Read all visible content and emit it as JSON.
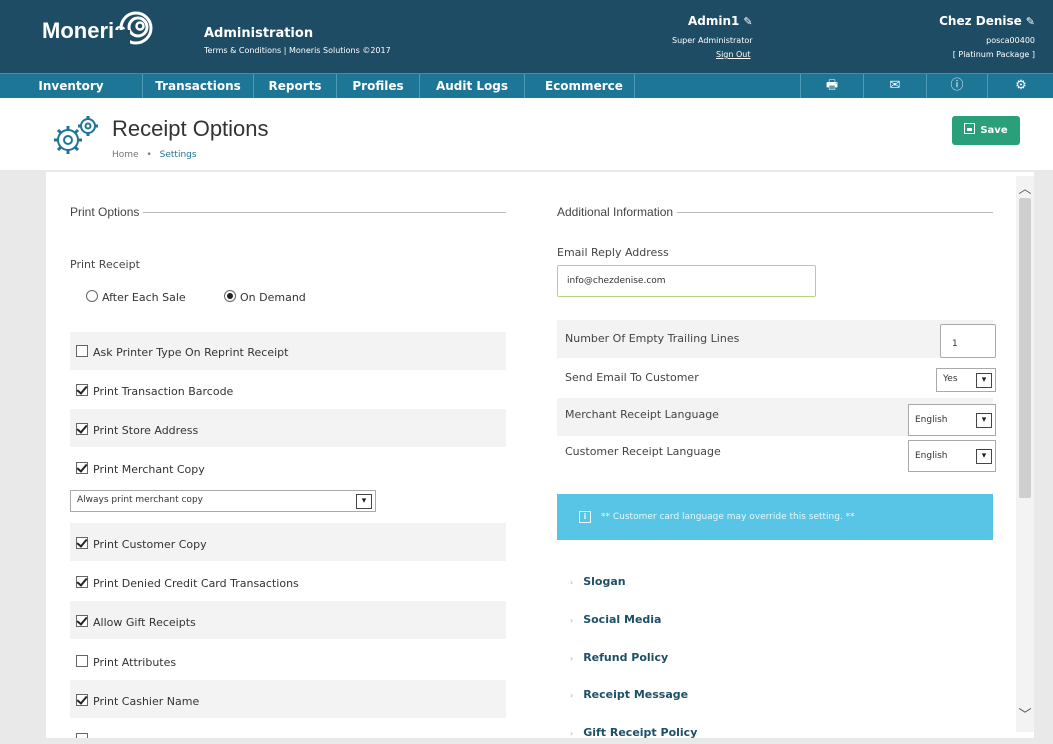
{
  "header": {
    "logo_text": "Moneris",
    "admin_title": "Administration",
    "admin_sub": "Terms & Conditions | Moneris Solutions ©2017",
    "user_name": "Admin1",
    "user_role": "Super Administrator",
    "sign_out": "Sign Out",
    "store_name": "Chez Denise",
    "store_id": "posca00400",
    "store_package": "[ Platinum Package ]"
  },
  "nav": {
    "items": [
      "Inventory",
      "Transactions",
      "Reports",
      "Profiles",
      "Audit Logs",
      "Ecommerce"
    ],
    "icons": [
      "printer-icon",
      "mail-icon",
      "help-icon",
      "settings-icon"
    ]
  },
  "page": {
    "title": "Receipt Options",
    "breadcrumb_home": "Home",
    "breadcrumb_sep": "•",
    "breadcrumb_current": "Settings",
    "save_label": "Save"
  },
  "print_options": {
    "section_title": "Print Options",
    "print_receipt_label": "Print Receipt",
    "radio_after_each_sale": "After Each Sale",
    "radio_on_demand": "On Demand",
    "selected_radio": "On Demand",
    "checkboxes": [
      {
        "label": "Ask Printer Type On Reprint Receipt",
        "checked": false
      },
      {
        "label": "Print Transaction Barcode",
        "checked": true
      },
      {
        "label": "Print Store Address",
        "checked": true
      },
      {
        "label": "Print Merchant Copy",
        "checked": true
      },
      {
        "label": "Print Customer Copy",
        "checked": true
      },
      {
        "label": "Print Denied Credit Card Transactions",
        "checked": true
      },
      {
        "label": "Allow Gift Receipts",
        "checked": true
      },
      {
        "label": "Print Attributes",
        "checked": false
      },
      {
        "label": "Print Cashier Name",
        "checked": true
      }
    ],
    "merchant_copy_select": "Always print merchant copy"
  },
  "additional_info": {
    "section_title": "Additional Information",
    "email_reply_label": "Email Reply Address",
    "email_reply_value": "info@chezdenise.com",
    "trailing_lines_label": "Number Of Empty Trailing Lines",
    "trailing_lines_value": "1",
    "send_email_label": "Send Email To Customer",
    "send_email_value": "Yes",
    "merchant_lang_label": "Merchant Receipt Language",
    "merchant_lang_value": "English",
    "customer_lang_label": "Customer Receipt Language",
    "customer_lang_value": "English",
    "info_note": "** Customer card language may override this setting. **",
    "accordion": [
      "Slogan",
      "Social Media",
      "Refund Policy",
      "Receipt Message",
      "Gift Receipt Policy"
    ]
  },
  "colors": {
    "header_bg": "#1e4c64",
    "nav_bg": "#1e7696",
    "save_bg": "#2aa07a",
    "info_bg": "#58c4e6"
  }
}
